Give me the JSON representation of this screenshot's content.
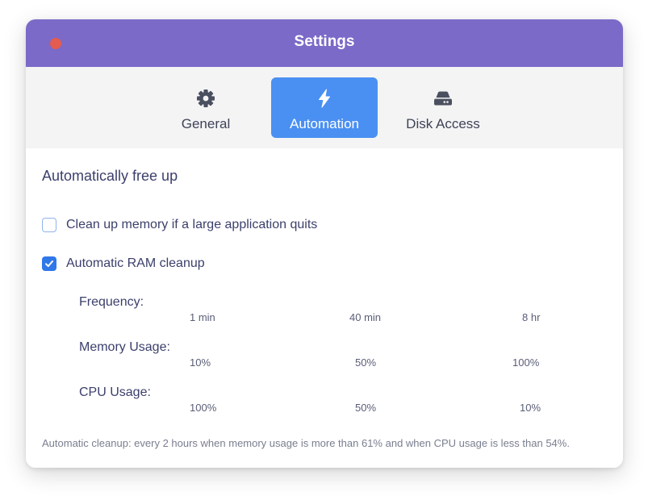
{
  "window": {
    "title": "Settings"
  },
  "tabs": [
    {
      "label": "General",
      "icon": "gear-icon",
      "active": false
    },
    {
      "label": "Automation",
      "icon": "lightning-icon",
      "active": true
    },
    {
      "label": "Disk Access",
      "icon": "disk-icon",
      "active": false
    }
  ],
  "automation": {
    "section_title": "Automatically free up",
    "options": [
      {
        "label": "Clean up memory if a large application quits",
        "checked": false
      },
      {
        "label": "Automatic RAM cleanup",
        "checked": true
      }
    ],
    "frequency": {
      "label": "Frequency:",
      "ticks": [
        "1 min",
        "40 min",
        "8 hr"
      ]
    },
    "memory_usage": {
      "label": "Memory Usage:",
      "ticks": [
        "10%",
        "50%",
        "100%"
      ]
    },
    "cpu_usage": {
      "label": "CPU Usage:",
      "ticks": [
        "100%",
        "50%",
        "10%"
      ]
    },
    "summary": "Automatic cleanup: every 2 hours when memory usage is more than 61% and when CPU usage is less than 54%."
  },
  "colors": {
    "titlebar": "#7b6ac8",
    "active_tab": "#4a90f2",
    "checkbox_checked": "#2f78e8",
    "close_button": "#e35c4f"
  }
}
